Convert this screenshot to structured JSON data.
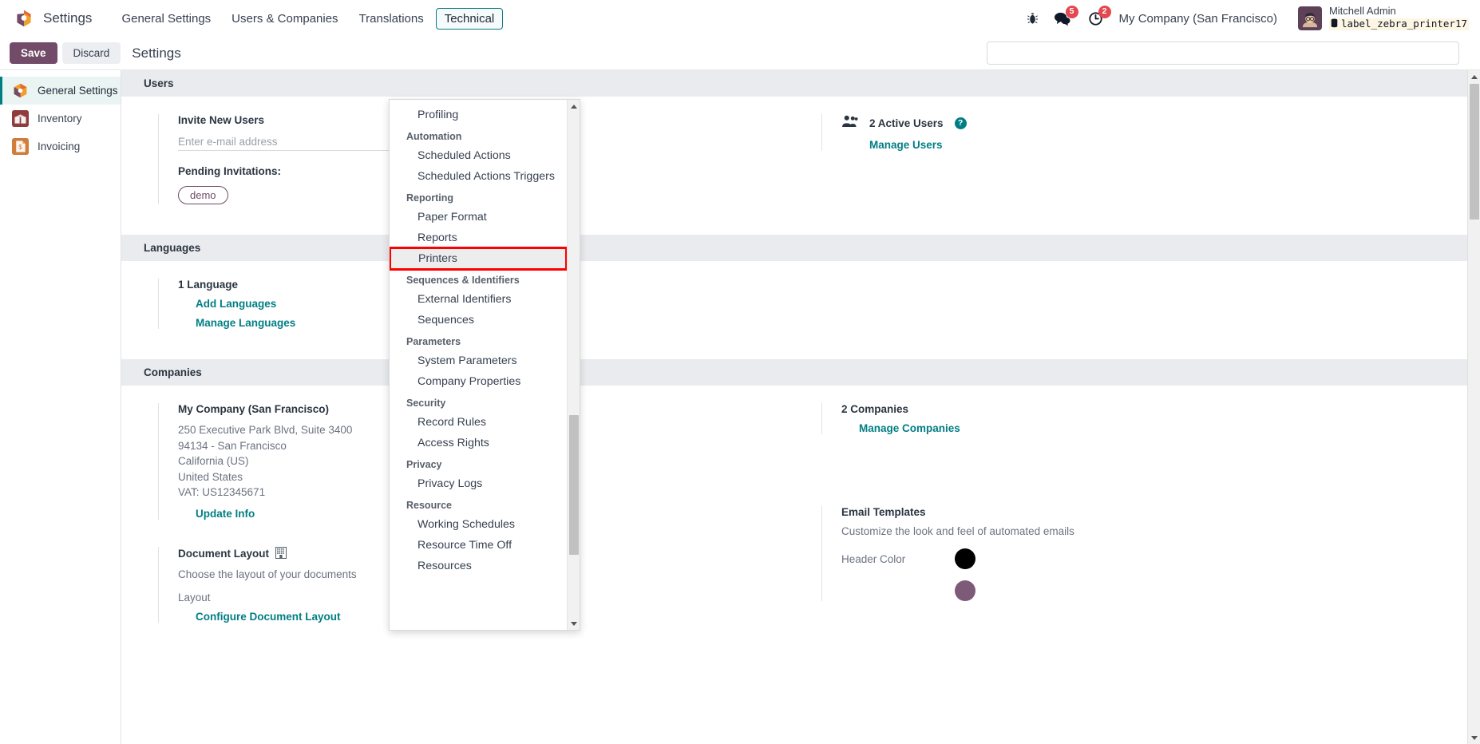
{
  "navbar": {
    "brand": "Settings",
    "menu_items": [
      {
        "label": "General Settings",
        "active": false
      },
      {
        "label": "Users & Companies",
        "active": false
      },
      {
        "label": "Translations",
        "active": false
      },
      {
        "label": "Technical",
        "active": true
      }
    ],
    "bug_icon": "bug-icon",
    "messages_badge": "5",
    "activities_badge": "2",
    "company": "My Company (San Francisco)",
    "user_name": "Mitchell Admin",
    "database": "label_zebra_printer17"
  },
  "control_panel": {
    "save_label": "Save",
    "discard_label": "Discard",
    "breadcrumb": "Settings",
    "search_value": "",
    "search_placeholder": ""
  },
  "sidebar": {
    "items": [
      {
        "label": "General Settings",
        "icon": "settings-gear-icon",
        "active": true
      },
      {
        "label": "Inventory",
        "icon": "inventory-box-icon",
        "active": false
      },
      {
        "label": "Invoicing",
        "icon": "invoicing-document-icon",
        "active": false
      }
    ]
  },
  "sections": {
    "users": {
      "heading": "Users",
      "invite_title": "Invite New Users",
      "invite_placeholder": "Enter e-mail address",
      "invite_value": "",
      "pending_label": "Pending Invitations:",
      "pending_chips": [
        "demo"
      ],
      "active_users_count": "2 Active Users",
      "manage_users_link": "Manage Users",
      "help_glyph": "?"
    },
    "languages": {
      "heading": "Languages",
      "count_label": "1 Language",
      "add_link": "Add Languages",
      "manage_link": "Manage Languages"
    },
    "companies": {
      "heading": "Companies",
      "company_name": "My Company (San Francisco)",
      "address": [
        "250 Executive Park Blvd, Suite 3400",
        "94134 - San Francisco",
        "California (US)",
        "United States",
        "VAT:  US12345671"
      ],
      "update_link": "Update Info",
      "count_label": "2 Companies",
      "manage_link": "Manage Companies",
      "document_layout": {
        "title": "Document Layout",
        "icon": "building-icon",
        "subtitle": "Choose the layout of your documents",
        "layout_label": "Layout",
        "configure_link": "Configure Document Layout"
      },
      "email_templates": {
        "title": "Email Templates",
        "subtitle": "Customize the look and feel of automated emails",
        "header_color_label": "Header Color",
        "header_color": "#000000",
        "second_color": "#7d5a78"
      }
    }
  },
  "dropdown": {
    "groups": [
      {
        "header": null,
        "items": [
          {
            "label": "Profiling",
            "highlighted": false
          }
        ]
      },
      {
        "header": "Automation",
        "items": [
          {
            "label": "Scheduled Actions",
            "highlighted": false
          },
          {
            "label": "Scheduled Actions Triggers",
            "highlighted": false
          }
        ]
      },
      {
        "header": "Reporting",
        "items": [
          {
            "label": "Paper Format",
            "highlighted": false
          },
          {
            "label": "Reports",
            "highlighted": false
          },
          {
            "label": "Printers",
            "highlighted": true
          }
        ]
      },
      {
        "header": "Sequences & Identifiers",
        "items": [
          {
            "label": "External Identifiers",
            "highlighted": false
          },
          {
            "label": "Sequences",
            "highlighted": false
          }
        ]
      },
      {
        "header": "Parameters",
        "items": [
          {
            "label": "System Parameters",
            "highlighted": false
          },
          {
            "label": "Company Properties",
            "highlighted": false
          }
        ]
      },
      {
        "header": "Security",
        "items": [
          {
            "label": "Record Rules",
            "highlighted": false
          },
          {
            "label": "Access Rights",
            "highlighted": false
          }
        ]
      },
      {
        "header": "Privacy",
        "items": [
          {
            "label": "Privacy Logs",
            "highlighted": false
          }
        ]
      },
      {
        "header": "Resource",
        "items": [
          {
            "label": "Working Schedules",
            "highlighted": false
          },
          {
            "label": "Resource Time Off",
            "highlighted": false
          },
          {
            "label": "Resources",
            "highlighted": false
          }
        ]
      }
    ]
  },
  "colors": {
    "accent_teal": "#017e84",
    "brand_purple": "#714b67",
    "badge_red": "#e4474f",
    "highlight_red": "#ff0000"
  }
}
